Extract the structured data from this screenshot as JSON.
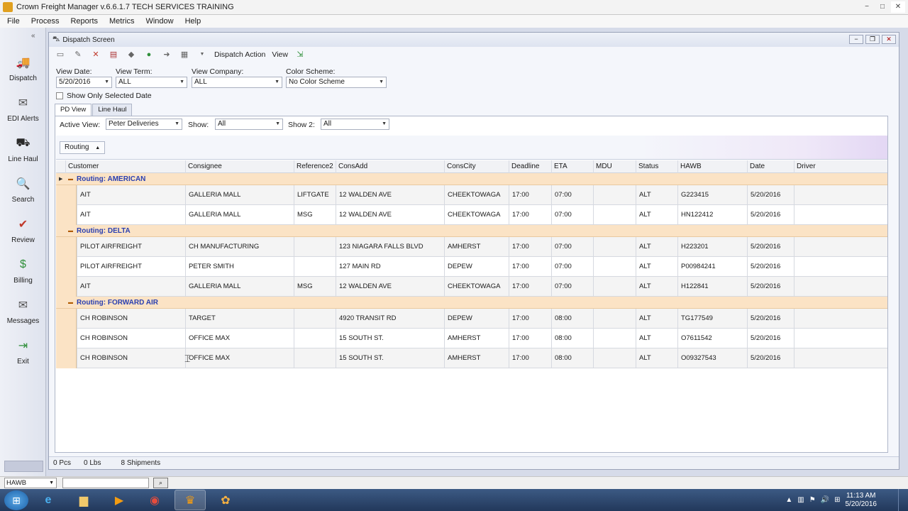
{
  "app": {
    "title": "Crown Freight Manager v.6.6.1.7 TECH SERVICES TRAINING",
    "window_controls": [
      "−",
      "□",
      "✕"
    ]
  },
  "menu": [
    "File",
    "Process",
    "Reports",
    "Metrics",
    "Window",
    "Help"
  ],
  "sidebar": {
    "collapse": "«",
    "items": [
      {
        "label": "Dispatch",
        "icon": "truck-icon",
        "glyph": "🚚",
        "color": "#3b6fb6"
      },
      {
        "label": "EDI Alerts",
        "icon": "envelope-icon",
        "glyph": "✉",
        "color": "#555"
      },
      {
        "label": "Line Haul",
        "icon": "forklift-icon",
        "glyph": "⛟",
        "color": "#2a2a2a"
      },
      {
        "label": "Search",
        "icon": "magnifier-icon",
        "glyph": "🔍",
        "color": "#3b6fb6"
      },
      {
        "label": "Review",
        "icon": "checklist-icon",
        "glyph": "✔",
        "color": "#c0392b"
      },
      {
        "label": "Billing",
        "icon": "money-icon",
        "glyph": "$",
        "color": "#2f8f3a"
      },
      {
        "label": "Messages",
        "icon": "mail-icon",
        "glyph": "✉",
        "color": "#555"
      },
      {
        "label": "Exit",
        "icon": "exit-icon",
        "glyph": "⇥",
        "color": "#2f8f3a"
      }
    ]
  },
  "dispatch": {
    "title": "Dispatch Screen",
    "toolbar": {
      "dispatch_action": "Dispatch Action",
      "view": "View"
    },
    "filters": {
      "view_date_label": "View Date:",
      "view_date": "5/20/2016",
      "view_term_label": "View Term:",
      "view_term": "ALL",
      "view_company_label": "View Company:",
      "view_company": "ALL",
      "color_scheme_label": "Color Scheme:",
      "color_scheme": "No Color Scheme",
      "show_only_selected": "Show Only Selected Date"
    },
    "tabs": [
      "PD View",
      "Line Haul"
    ],
    "active_view_label": "Active View:",
    "active_view": "Peter Deliveries",
    "show_label": "Show:",
    "show": "All",
    "show2_label": "Show 2:",
    "show2": "All",
    "group_chip": "Routing",
    "columns": [
      "Customer",
      "Consignee",
      "Reference2",
      "ConsAdd",
      "ConsCity",
      "Deadline",
      "ETA",
      "MDU",
      "Status",
      "HAWB",
      "Date",
      "Driver"
    ],
    "groups": [
      {
        "label": "Routing: AMERICAN",
        "rows": [
          [
            "AIT",
            "GALLERIA MALL",
            "LIFTGATE",
            "12 WALDEN AVE",
            "CHEEKTOWAGA",
            "17:00",
            "07:00",
            "",
            "ALT",
            "G223415",
            "5/20/2016",
            ""
          ],
          [
            "AIT",
            "GALLERIA MALL",
            "MSG",
            "12 WALDEN AVE",
            "CHEEKTOWAGA",
            "17:00",
            "07:00",
            "",
            "ALT",
            "HN122412",
            "5/20/2016",
            ""
          ]
        ]
      },
      {
        "label": "Routing: DELTA",
        "rows": [
          [
            "PILOT AIRFREIGHT",
            "CH MANUFACTURING",
            "",
            "123 NIAGARA FALLS BLVD",
            "AMHERST",
            "17:00",
            "07:00",
            "",
            "ALT",
            "H223201",
            "5/20/2016",
            ""
          ],
          [
            "PILOT AIRFREIGHT",
            "PETER SMITH",
            "",
            "127 MAIN RD",
            "DEPEW",
            "17:00",
            "07:00",
            "",
            "ALT",
            "P00984241",
            "5/20/2016",
            ""
          ],
          [
            "AIT",
            "GALLERIA MALL",
            "MSG",
            "12 WALDEN AVE",
            "CHEEKTOWAGA",
            "17:00",
            "07:00",
            "",
            "ALT",
            "H122841",
            "5/20/2016",
            ""
          ]
        ]
      },
      {
        "label": "Routing: FORWARD AIR",
        "rows": [
          [
            "CH ROBINSON",
            "TARGET",
            "",
            "4920 TRANSIT RD",
            "DEPEW",
            "17:00",
            "08:00",
            "",
            "ALT",
            "TG177549",
            "5/20/2016",
            ""
          ],
          [
            "CH ROBINSON",
            "OFFICE MAX",
            "",
            "15 SOUTH ST.",
            "AMHERST",
            "17:00",
            "08:00",
            "",
            "ALT",
            "O7611542",
            "5/20/2016",
            ""
          ],
          [
            "CH ROBINSON",
            "OFFICE MAX",
            "",
            "15 SOUTH ST.",
            "AMHERST",
            "17:00",
            "08:00",
            "",
            "ALT",
            "O09327543",
            "5/20/2016",
            ""
          ]
        ]
      }
    ],
    "status": {
      "pcs": "0 Pcs",
      "lbs": "0 Lbs",
      "shipments": "8 Shipments"
    }
  },
  "search_strip": {
    "field": "HAWB"
  },
  "taskbar": {
    "time": "11:13 AM",
    "date": "5/20/2016"
  }
}
